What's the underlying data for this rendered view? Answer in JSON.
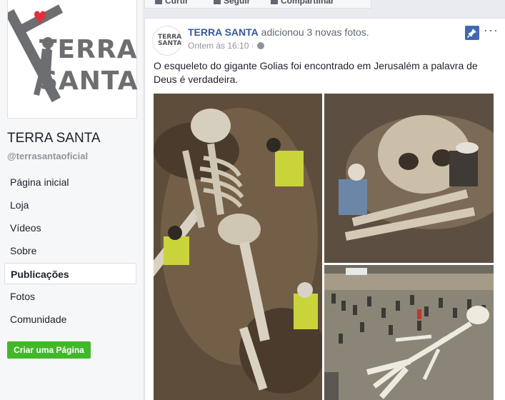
{
  "sidebar": {
    "page_name": "TERRA SANTA",
    "handle": "@terrasantaoficial",
    "logo_line1": "TERRA",
    "logo_line2": "SANTA",
    "nav": [
      {
        "label": "Página inicial"
      },
      {
        "label": "Loja"
      },
      {
        "label": "Vídeos"
      },
      {
        "label": "Sobre"
      },
      {
        "label": "Publicações",
        "active": true
      },
      {
        "label": "Fotos"
      },
      {
        "label": "Comunidade"
      }
    ],
    "create_button": "Criar uma Página"
  },
  "actions": {
    "like": "Curtir",
    "follow": "Seguir",
    "share": "Compartilhar"
  },
  "post": {
    "avatar_line1": "TERRA",
    "avatar_line2": "SANTA",
    "author": "TERRA SANTA",
    "action_text": "adicionou 3 novas fotos.",
    "timestamp": "Ontem às 16:10 ·",
    "text": "O esqueleto do gigante Golias foi encontrado em Jerusalém a palavra de Deus é verdadeira.",
    "more": "···"
  },
  "colors": {
    "link": "#365899",
    "accent": "#4267b2",
    "create_button": "#42b72a",
    "logo_heart": "#e0303a"
  }
}
